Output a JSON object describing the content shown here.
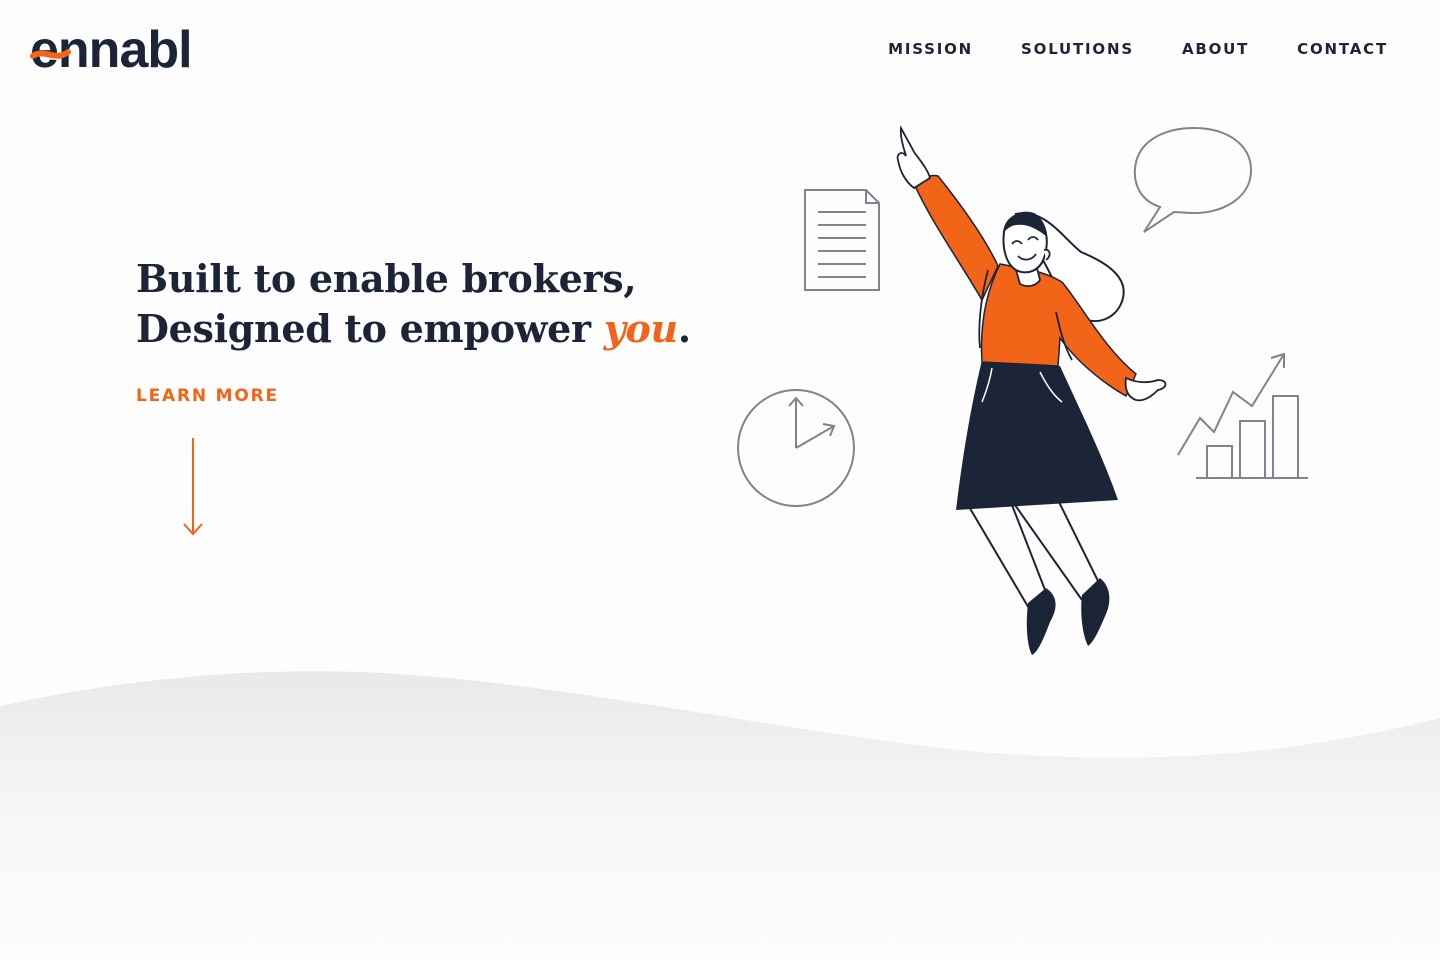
{
  "brand": {
    "logo_text": "ennabl",
    "colors": {
      "accent": "#f26417",
      "navy": "#1c2438",
      "line_gray": "#7f838d"
    }
  },
  "nav": {
    "items": [
      {
        "label": "MISSION"
      },
      {
        "label": "SOLUTIONS"
      },
      {
        "label": "ABOUT"
      },
      {
        "label": "CONTACT"
      }
    ]
  },
  "hero": {
    "line1": "Built to enable brokers,",
    "line2_prefix": "Designed to empower ",
    "line2_accent": "you",
    "line2_suffix": ".",
    "cta_label": "LEARN MORE",
    "scroll_icon": "arrow-down-icon"
  },
  "illustration": {
    "icons": [
      "document-icon",
      "speech-bubble-icon",
      "clock-icon",
      "growth-chart-icon"
    ],
    "figure": "woman-jumping-illustration"
  }
}
